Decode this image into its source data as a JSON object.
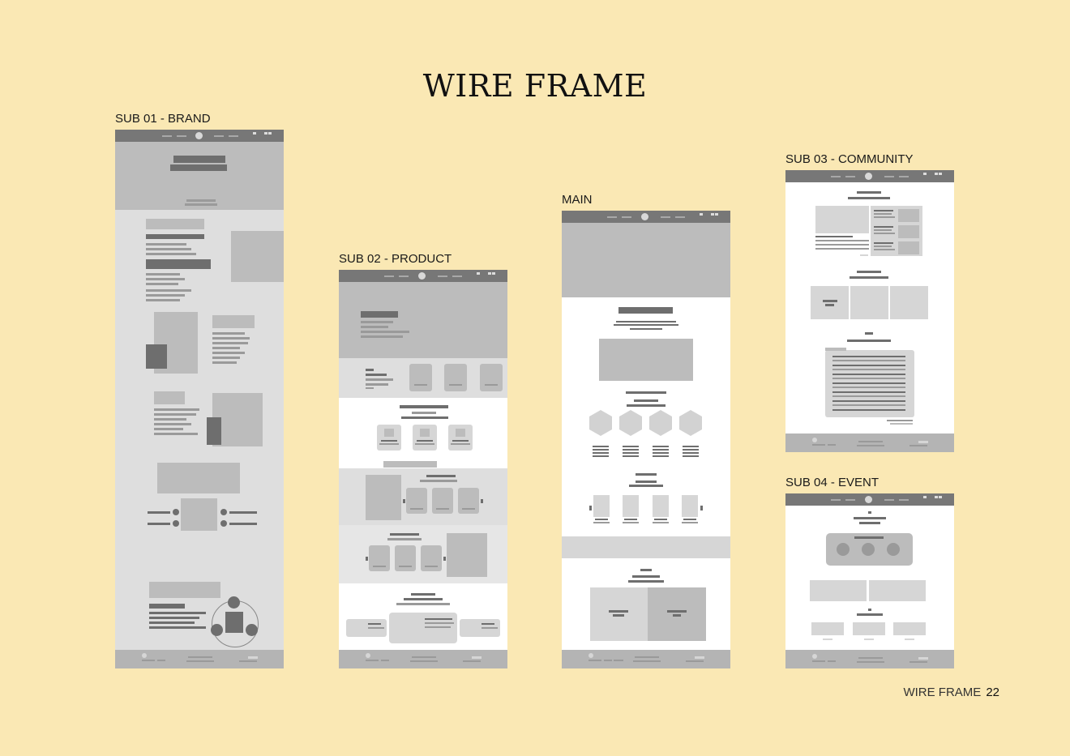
{
  "title": "WIRE FRAME",
  "frames": {
    "brand": {
      "label": "SUB 01 - BRAND"
    },
    "product": {
      "label": "SUB 02 - PRODUCT"
    },
    "main": {
      "label": "MAIN"
    },
    "community": {
      "label": "SUB 03 - COMMUNITY"
    },
    "event": {
      "label": "SUB 04 - EVENT"
    }
  },
  "footer": {
    "section": "WIRE FRAME",
    "page": "22"
  },
  "colors": {
    "background": "#fae8b4",
    "nav": "#777777",
    "block_dark": "#6e6e6e",
    "block_light": "#bcbcbc"
  }
}
